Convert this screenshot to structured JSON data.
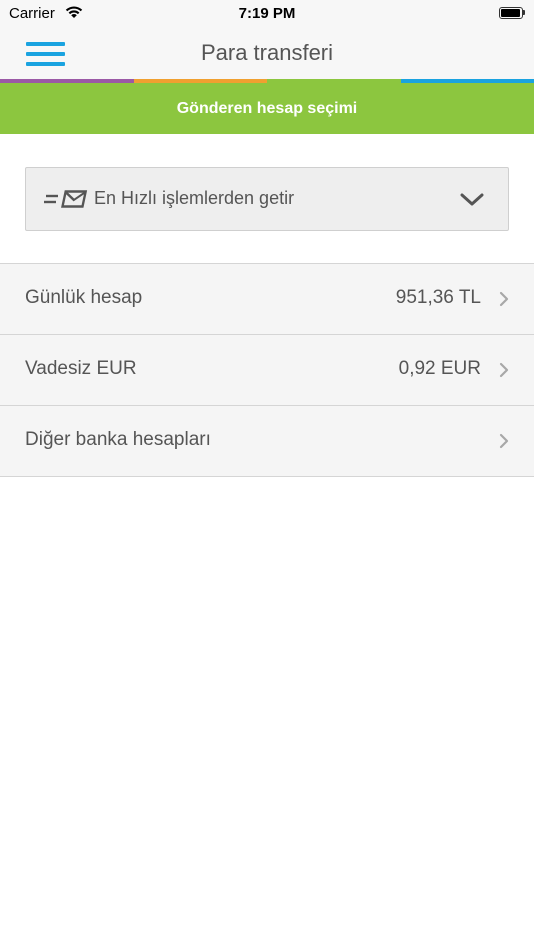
{
  "status_bar": {
    "carrier": "Carrier",
    "time": "7:19 PM"
  },
  "nav": {
    "title": "Para transferi",
    "menu_icon": "hamburger-menu-icon",
    "accent_color": "#1aa3e0",
    "stripe_colors": [
      "#9b59a6",
      "#f0a030",
      "#8cc63f",
      "#1aa3e0"
    ]
  },
  "section": {
    "title": "Gönderen hesap seçimi",
    "color": "#8cc63f"
  },
  "quick_select": {
    "label": "En Hızlı işlemlerden getir",
    "icon": "fast-mail-icon",
    "dropdown_icon": "chevron-down-icon"
  },
  "accounts": [
    {
      "label": "Günlük hesap",
      "value": "951,36 TL"
    },
    {
      "label": "Vadesiz EUR",
      "value": "0,92 EUR"
    },
    {
      "label": "Diğer banka hesapları",
      "value": ""
    }
  ]
}
